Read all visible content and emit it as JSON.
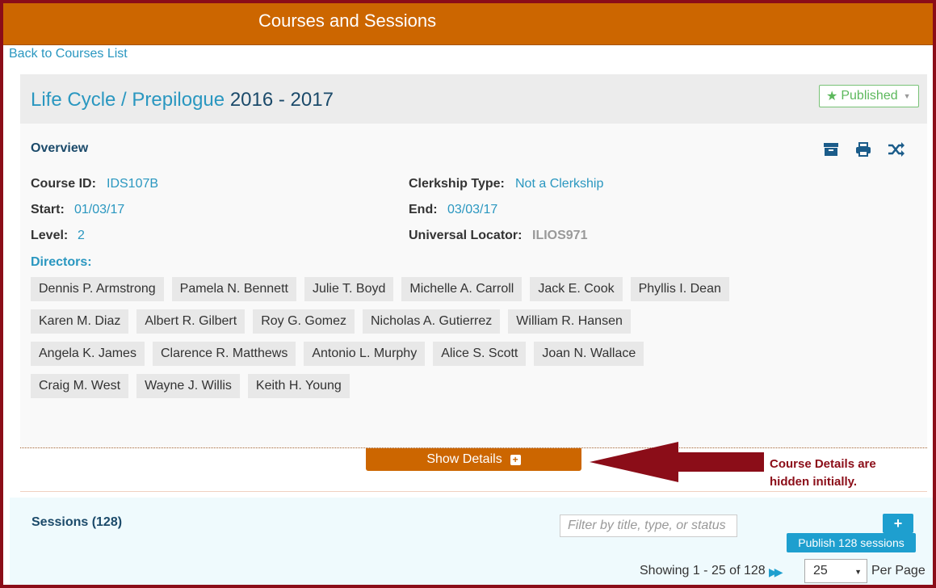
{
  "header": {
    "title": "Courses and Sessions"
  },
  "nav": {
    "back_link": "Back to Courses List"
  },
  "course": {
    "title": "Life Cycle / Prepilogue",
    "year": "2016 - 2017",
    "status_label": "Published"
  },
  "overview": {
    "title": "Overview",
    "tools": [
      "archive-icon",
      "print-icon",
      "rollover-icon"
    ],
    "fields": {
      "course_id": {
        "label": "Course ID:",
        "value": "IDS107B"
      },
      "clerkship_type": {
        "label": "Clerkship Type:",
        "value": "Not a Clerkship"
      },
      "start": {
        "label": "Start:",
        "value": "01/03/17"
      },
      "end": {
        "label": "End:",
        "value": "03/03/17"
      },
      "level": {
        "label": "Level:",
        "value": "2"
      },
      "universal_locator": {
        "label": "Universal Locator:",
        "value": "ILIOS971"
      }
    },
    "directors_label": "Directors:",
    "directors": [
      "Dennis P. Armstrong",
      "Pamela N. Bennett",
      "Julie T. Boyd",
      "Michelle A. Carroll",
      "Jack E. Cook",
      "Phyllis I. Dean",
      "Karen M. Diaz",
      "Albert R. Gilbert",
      "Roy G. Gomez",
      "Nicholas A. Gutierrez",
      "William R. Hansen",
      "Angela K. James",
      "Clarence R. Matthews",
      "Antonio L. Murphy",
      "Alice S. Scott",
      "Joan N. Wallace",
      "Craig M. West",
      "Wayne J. Willis",
      "Keith H. Young"
    ]
  },
  "details": {
    "show_label": "Show Details"
  },
  "annotation": {
    "line1": "Course Details are",
    "line2": "hidden initially."
  },
  "sessions": {
    "title": "Sessions (128)",
    "filter_placeholder": "Filter by title, type, or status",
    "add_label": "+",
    "publish_label": "Publish 128 sessions",
    "showing": "Showing 1 - 25 of 128",
    "per_page_value": "25",
    "per_page_label": "Per Page"
  },
  "colors": {
    "header": "#cc6600",
    "accent": "#2a97c0",
    "published": "#5cb85c",
    "frame": "#8b0d18"
  }
}
